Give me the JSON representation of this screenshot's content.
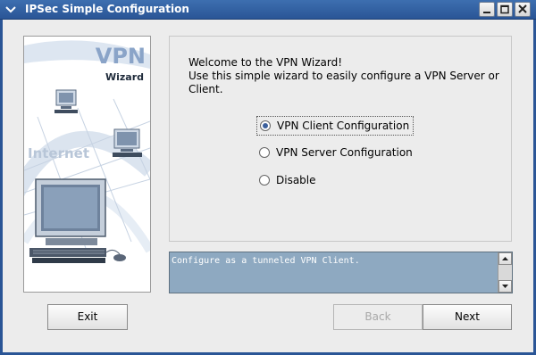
{
  "window": {
    "title": "IPSec Simple Configuration",
    "menu_icon": "chevron-down-icon",
    "controls": {
      "minimize_icon": "minimize-icon",
      "maximize_icon": "maximize-icon",
      "close_icon": "close-icon"
    },
    "title_bar_color": "#2a5596"
  },
  "art_panel": {
    "heading": "VPN",
    "subheading": "Wizard",
    "network_label": "Internet",
    "accent_color": "#8aa4c8"
  },
  "welcome": {
    "line1": "Welcome to the VPN Wizard!",
    "line2": "Use this simple wizard to easily configure a VPN Server or Client."
  },
  "options": {
    "client": {
      "label": "VPN Client Configuration",
      "checked": true
    },
    "server": {
      "label": "VPN Server Configuration",
      "checked": false
    },
    "disable": {
      "label": "Disable",
      "checked": false
    }
  },
  "description": {
    "text": "Configure as a tunneled VPN Client."
  },
  "buttons": {
    "exit": "Exit",
    "back": "Back",
    "next": "Next"
  }
}
